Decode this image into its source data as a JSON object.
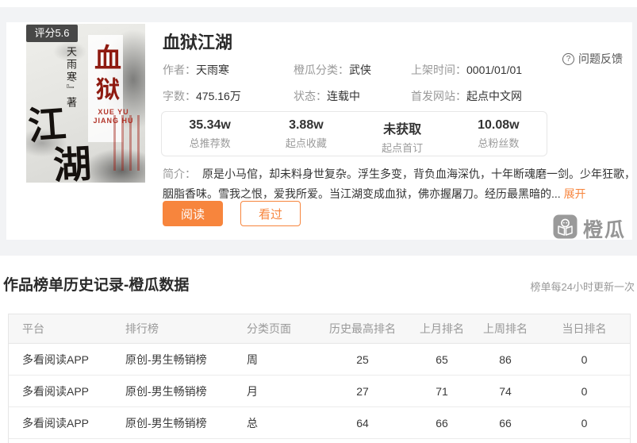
{
  "book": {
    "title": "血狱江湖",
    "rating_badge": "评分5.6",
    "cover": {
      "char1": "血",
      "char2": "狱",
      "char3": "江",
      "char4": "湖",
      "english_line1": "XUE YU",
      "english_line2": "JIANG HU",
      "author_vertical": "天雨寒﹄著"
    },
    "meta": [
      {
        "label": "作者：",
        "value": "天雨寒"
      },
      {
        "label": "橙瓜分类：",
        "value": "武侠"
      },
      {
        "label": "上架时间：",
        "value": "0001/01/01"
      },
      {
        "label": "字数：",
        "value": "475.16万"
      },
      {
        "label": "状态：",
        "value": "连载中"
      },
      {
        "label": "首发网站：",
        "value": "起点中文网"
      }
    ],
    "stats": [
      {
        "value": "35.34w",
        "label": "总推荐数"
      },
      {
        "value": "3.88w",
        "label": "起点收藏"
      },
      {
        "value": "未获取",
        "label": "起点首订"
      },
      {
        "value": "10.08w",
        "label": "总粉丝数"
      }
    ],
    "intro_label": "简介：",
    "intro_text": "原是小马倌，却未料身世复杂。浮生多变，背负血海深仇，十年断魂磨一剑。少年狂歌，胭脂香味。雪我之恨，爱我所爱。当江湖变成血狱，佛亦握屠刀。经历最黑暗的...",
    "expand_label": "展开",
    "read_button": "阅读",
    "seen_button": "看过",
    "feedback_label": "问题反馈",
    "watermark_text": "橙瓜"
  },
  "ranking_section": {
    "title": "作品榜单历史记录-橙瓜数据",
    "update_note": "榜单每24小时更新一次",
    "table": {
      "headers": [
        "平台",
        "排行榜",
        "分类页面",
        "历史最高排名",
        "上月排名",
        "上周排名",
        "当日排名"
      ],
      "rows": [
        {
          "platform": "多看阅读APP",
          "board": "原创-男生畅销榜",
          "page": "周",
          "best": "25",
          "last_month": "65",
          "last_week": "86",
          "today": "0"
        },
        {
          "platform": "多看阅读APP",
          "board": "原创-男生畅销榜",
          "page": "月",
          "best": "27",
          "last_month": "71",
          "last_week": "74",
          "today": "0"
        },
        {
          "platform": "多看阅读APP",
          "board": "原创-男生畅销榜",
          "page": "总",
          "best": "64",
          "last_month": "66",
          "last_week": "66",
          "today": "0"
        }
      ]
    }
  },
  "colors": {
    "accent": "#f7853d",
    "page_bg": "#f2f3f5",
    "badge_bg": "#2a2a2a",
    "cover_red": "#8e1a10"
  }
}
